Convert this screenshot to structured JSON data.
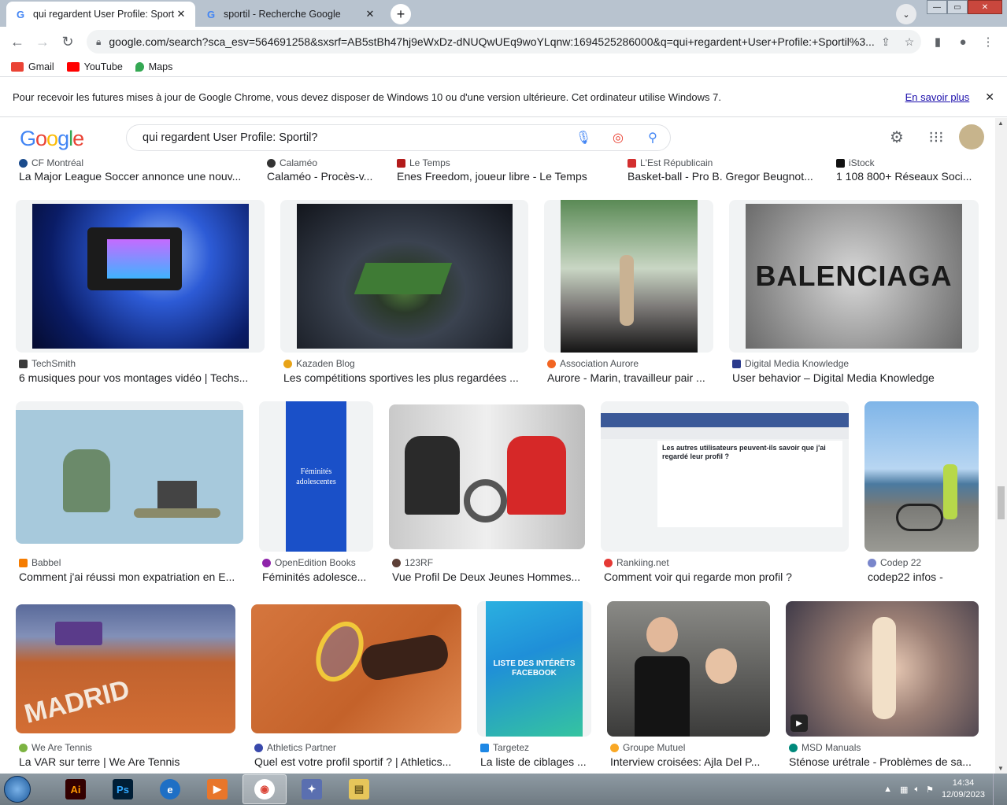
{
  "tabs": [
    {
      "title": "qui regardent User Profile: Sporti",
      "active": true
    },
    {
      "title": "sportil - Recherche Google",
      "active": false
    }
  ],
  "toolbar": {
    "url": "google.com/search?sca_esv=564691258&sxsrf=AB5stBh47hj9eWxDz-dNUQwUEq9woYLqnw:1694525286000&q=qui+regardent+User+Profile:+Sportil%3..."
  },
  "bookmarks": [
    {
      "label": "Gmail",
      "color": "#ea4335"
    },
    {
      "label": "YouTube",
      "color": "#ff0000"
    },
    {
      "label": "Maps",
      "color": "#34a853"
    }
  ],
  "infobar": {
    "message": "Pour recevoir les futures mises à jour de Google Chrome, vous devez disposer de Windows 10 ou d'une version ultérieure. Cet ordinateur utilise Windows 7.",
    "link": "En savoir plus"
  },
  "search": {
    "query": "qui regardent User Profile: Sportil?",
    "logo": "Google"
  },
  "results": [
    {
      "source": "CF Montréal",
      "title": "La Major League Soccer annonce une nouv...",
      "fav": "#1a4b8c"
    },
    {
      "source": "Calaméo",
      "title": "Calaméo - Procès-v...",
      "fav": "#333333"
    },
    {
      "source": "Le Temps",
      "title": "Enes Freedom, joueur libre - Le Temps",
      "fav": "#b31b1b"
    },
    {
      "source": "L'Est Républicain",
      "title": "Basket-ball - Pro B. Gregor Beugnot...",
      "fav": "#d32f2f"
    },
    {
      "source": "iStock",
      "title": "1 108 800+ Réseaux Soci...",
      "fav": "#111111"
    },
    {
      "source": "TechSmith",
      "title": "6 musiques pour vos montages vidéo | Techs...",
      "fav": "#3a3a3a"
    },
    {
      "source": "Kazaden Blog",
      "title": "Les compétitions sportives les plus regardées ...",
      "fav": "#e8a317"
    },
    {
      "source": "Association Aurore",
      "title": "Aurore - Marin, travailleur pair ...",
      "fav": "#f26522"
    },
    {
      "source": "Digital Media Knowledge",
      "title": "User behavior – Digital Media Knowledge",
      "fav": "#2b3a8c"
    },
    {
      "source": "Babbel",
      "title": "Comment j'ai réussi mon expatriation en E...",
      "fav": "#f57c00"
    },
    {
      "source": "OpenEdition Books",
      "title": "Féminités adolesce...",
      "fav": "#8e24aa"
    },
    {
      "source": "123RF",
      "title": "Vue Profil De Deux Jeunes Hommes...",
      "fav": "#5d4037"
    },
    {
      "source": "Rankiing.net",
      "title": "Comment voir qui regarde mon profil ?",
      "fav": "#e53935"
    },
    {
      "source": "Codep 22",
      "title": "codep22 infos -",
      "fav": "#7986cb"
    },
    {
      "source": "We Are Tennis",
      "title": "La VAR sur terre | We Are Tennis",
      "fav": "#7cb342"
    },
    {
      "source": "Athletics Partner",
      "title": "Quel est votre profil sportif ? | Athletics...",
      "fav": "#3949ab"
    },
    {
      "source": "Targetez",
      "title": "La liste de ciblages ...",
      "fav": "#1e88e5"
    },
    {
      "source": "Groupe Mutuel",
      "title": "Interview croisées: Ajla Del P...",
      "fav": "#f9a825"
    },
    {
      "source": "MSD Manuals",
      "title": "Sténose urétrale - Problèmes de sa...",
      "fav": "#00897b"
    }
  ],
  "image_text": {
    "balenciaga": "BALENCIAGA",
    "book_title": "Féminités adolescentes",
    "fb_heading": "Les autres utilisateurs peuvent-ils savoir que j'ai regardé leur profil ?",
    "target_heading": "LISTE DES INTÉRÊTS FACEBOOK",
    "madrid": "MADRID"
  },
  "taskbar": {
    "time": "14:34",
    "date": "12/09/2023",
    "apps": [
      {
        "name": "Ai",
        "color": "#330000",
        "fg": "#ff9a00"
      },
      {
        "name": "Ps",
        "color": "#001e36",
        "fg": "#31a8ff"
      },
      {
        "name": "e",
        "color": "#1e6fc5",
        "fg": "#ffffff"
      },
      {
        "name": "▶",
        "color": "#e8762b",
        "fg": "#ffffff"
      },
      {
        "name": "◉",
        "color": "#ffffff",
        "fg": "#db4437"
      },
      {
        "name": "✦",
        "color": "#5a6fb0",
        "fg": "#ffffff"
      },
      {
        "name": "▤",
        "color": "#e6c65a",
        "fg": "#6b5a1e"
      }
    ]
  }
}
